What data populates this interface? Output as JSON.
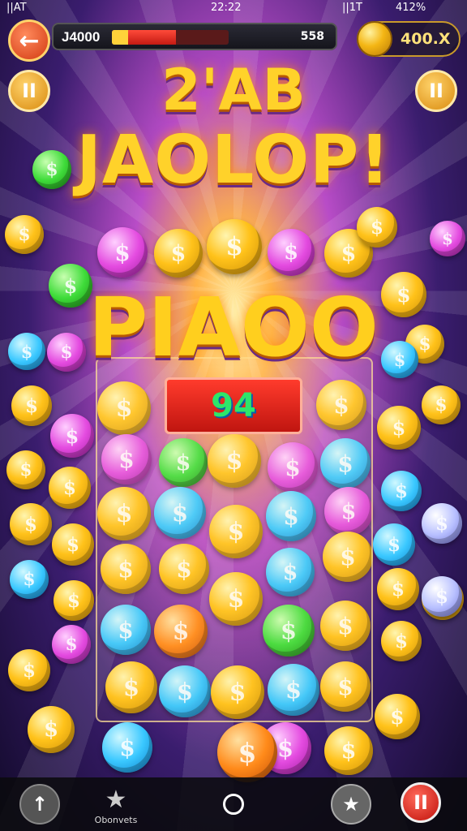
{
  "status_bar": {
    "left": "||AT",
    "time": "22:22",
    "network": "||1T",
    "battery": "412%"
  },
  "header": {
    "back_icon": "arrow-left-icon",
    "score_label": "J4000",
    "score_right": "558",
    "progress": 0.55,
    "coins": "400.X",
    "pause_left_label": "II",
    "pause_right_label": "II"
  },
  "titles": {
    "line1": "2'AB",
    "line2": "JAOLOP!",
    "big": "PIAOO"
  },
  "board": {
    "counter": "94"
  },
  "bottom_nav": {
    "up_icon": "arrow-up-icon",
    "star_label": "Obonvets",
    "star_icon": "star-icon",
    "home_icon": "circle-home-icon",
    "badge_icon": "star-badge-icon",
    "pause_icon": "pause-icon",
    "pause_label": "II"
  },
  "colors": {
    "gold": "#ffc21a",
    "pink": "#e44be0",
    "green": "#3fdc3a",
    "blue": "#3ac8ff",
    "lavender": "#b8c0ff",
    "orange": "#ff8a1a"
  },
  "coins": [
    {
      "color": "green"
    },
    {
      "color": "pink"
    },
    {
      "color": "gold"
    },
    {
      "color": "gold"
    },
    {
      "color": "pink"
    },
    {
      "color": "gold"
    },
    {
      "color": "gold"
    },
    {
      "color": "pink"
    },
    {
      "color": "green"
    },
    {
      "color": "gold"
    },
    {
      "color": "blue"
    },
    {
      "color": "gold"
    },
    {
      "color": "gold"
    },
    {
      "color": "pink"
    },
    {
      "color": "blue"
    },
    {
      "color": "gold"
    },
    {
      "color": "gold"
    },
    {
      "color": "gold"
    },
    {
      "color": "pink"
    },
    {
      "color": "gold"
    },
    {
      "color": "gold"
    },
    {
      "color": "pink"
    },
    {
      "color": "green"
    },
    {
      "color": "gold"
    },
    {
      "color": "pink"
    },
    {
      "color": "blue"
    },
    {
      "color": "gold"
    },
    {
      "color": "gold"
    },
    {
      "color": "blue"
    },
    {
      "color": "gold"
    },
    {
      "color": "gold"
    },
    {
      "color": "blue"
    },
    {
      "color": "gold"
    },
    {
      "color": "blue"
    },
    {
      "color": "pink"
    },
    {
      "color": "lav"
    },
    {
      "color": "gold"
    },
    {
      "color": "blue"
    },
    {
      "color": "gold"
    },
    {
      "color": "gold"
    },
    {
      "color": "blue"
    },
    {
      "color": "gold"
    },
    {
      "color": "blue"
    },
    {
      "color": "gold"
    },
    {
      "color": "gold"
    },
    {
      "color": "orange"
    },
    {
      "color": "green"
    },
    {
      "color": "gold"
    },
    {
      "color": "blue"
    },
    {
      "color": "gold"
    },
    {
      "color": "gold"
    },
    {
      "color": "pink"
    },
    {
      "color": "gold"
    },
    {
      "color": "gold"
    },
    {
      "color": "gold"
    },
    {
      "color": "blue"
    },
    {
      "color": "gold"
    },
    {
      "color": "blue"
    },
    {
      "color": "gold"
    },
    {
      "color": "pink"
    },
    {
      "color": "gold"
    },
    {
      "color": "orange"
    },
    {
      "color": "gold"
    },
    {
      "color": "lav"
    },
    {
      "color": "gold"
    },
    {
      "color": "blue"
    }
  ]
}
